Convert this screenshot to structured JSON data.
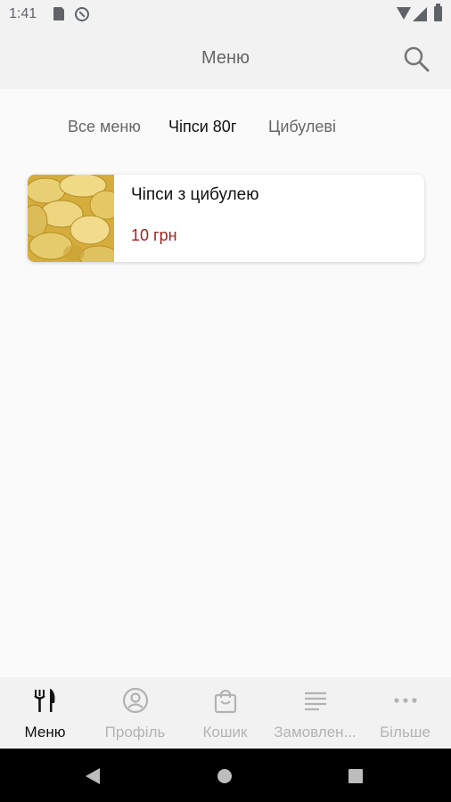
{
  "status_bar": {
    "time": "1:41"
  },
  "app_bar": {
    "title": "Меню"
  },
  "tabs": [
    {
      "label": "Все меню",
      "active": false
    },
    {
      "label": "Чіпси 80г",
      "active": true
    },
    {
      "label": "Цибулеві",
      "active": false
    }
  ],
  "products": [
    {
      "name": "Чіпси з цибулею",
      "price": "10 грн",
      "image_icon": "chips-photo"
    }
  ],
  "bottom_nav": [
    {
      "label": "Меню",
      "icon": "fork-knife-icon",
      "active": true
    },
    {
      "label": "Профіль",
      "icon": "profile-icon",
      "active": false
    },
    {
      "label": "Кошик",
      "icon": "shopping-bag-icon",
      "active": false
    },
    {
      "label": "Замовлен...",
      "icon": "list-icon",
      "active": false
    },
    {
      "label": "Більше",
      "icon": "more-icon",
      "active": false
    }
  ],
  "colors": {
    "price": "#a52020",
    "active_text": "#111111",
    "inactive_text": "#b3b3b3",
    "bar_background": "#f2f2f2"
  }
}
